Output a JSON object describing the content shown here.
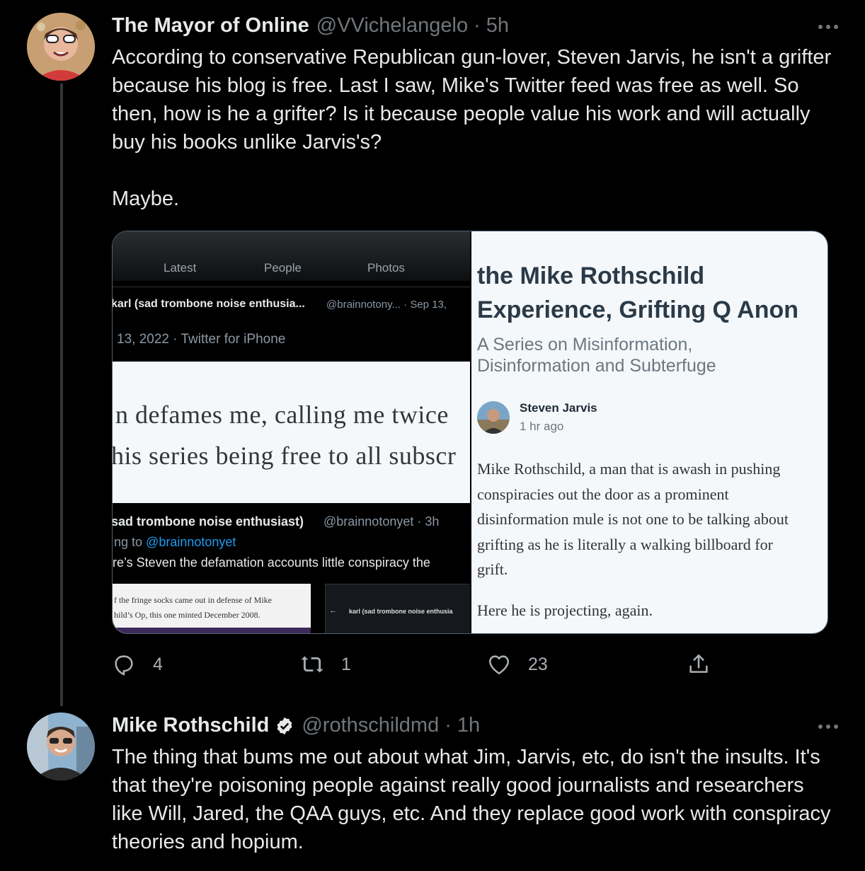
{
  "tweet1": {
    "name": "The Mayor of Online",
    "handle": "@VVichelangelo",
    "separator": "·",
    "time": "5h",
    "body": "According to conservative Republican gun-lover, Steven Jarvis, he isn't a grifter because his blog is free. Last I saw, Mike's Twitter feed was free as well. So then, how is he a grifter? Is it because people value his work and will actually buy his books unlike Jarvis's?\n\nMaybe.",
    "stats": {
      "replies": "4",
      "retweets": "1",
      "likes": "23"
    }
  },
  "image_left": {
    "tabs": [
      "Latest",
      "People",
      "Photos"
    ],
    "row1_name": "karl (sad trombone noise enthusia...",
    "row1_meta": "@brainnotony... · Sep 13,",
    "row2": "13, 2022 · Twitter for iPhone",
    "quote_line1": "n defames me, calling me twice",
    "quote_line2": "his series being free to all subscr",
    "row3_name": "sad trombone noise enthusiast)",
    "row3_meta": "@brainnotonyet · 3h",
    "row4_prefix": "ng to ",
    "row4_link": "@brainnotonyet",
    "row5": "re’s Steven the defamation accounts little conspiracy the",
    "thumb_line1": "f the fringe socks came out in defense of Mike",
    "thumb_line2": "hild’s Op, this one minted December 2008.",
    "thumb2_name": "karl (sad trombone noise enthusia"
  },
  "image_right": {
    "title_line1": "the Mike Rothschild",
    "title_line2": "Experience, Grifting Q Anon",
    "subtitle_line1": "A Series on Misinformation,",
    "subtitle_line2": "Disinformation and Subterfuge",
    "author": "Steven Jarvis",
    "time": "1 hr ago",
    "para_lines": [
      "Mike Rothschild, a man that is awash in pushing",
      "conspiracies out the door as a prominent",
      "disinformation mule is not one to be talking about",
      "grifting as he is literally a walking billboard for",
      "grift."
    ],
    "para2": "Here he is projecting, again."
  },
  "tweet2": {
    "name": "Mike Rothschild",
    "handle": "@rothschildmd",
    "separator": "·",
    "time": "1h",
    "body": "The thing that bums me out about what Jim, Jarvis, etc, do isn't the insults. It's that they're poisoning people against really good journalists and researchers like Will, Jared, the QAA guys, etc. And they replace good work with conspiracy theories and hopium."
  },
  "colors": {
    "background": "#000000",
    "text": "#e7e9ea",
    "muted": "#71767b",
    "link": "#1d9bf0",
    "verified": "#e7e9ea"
  }
}
